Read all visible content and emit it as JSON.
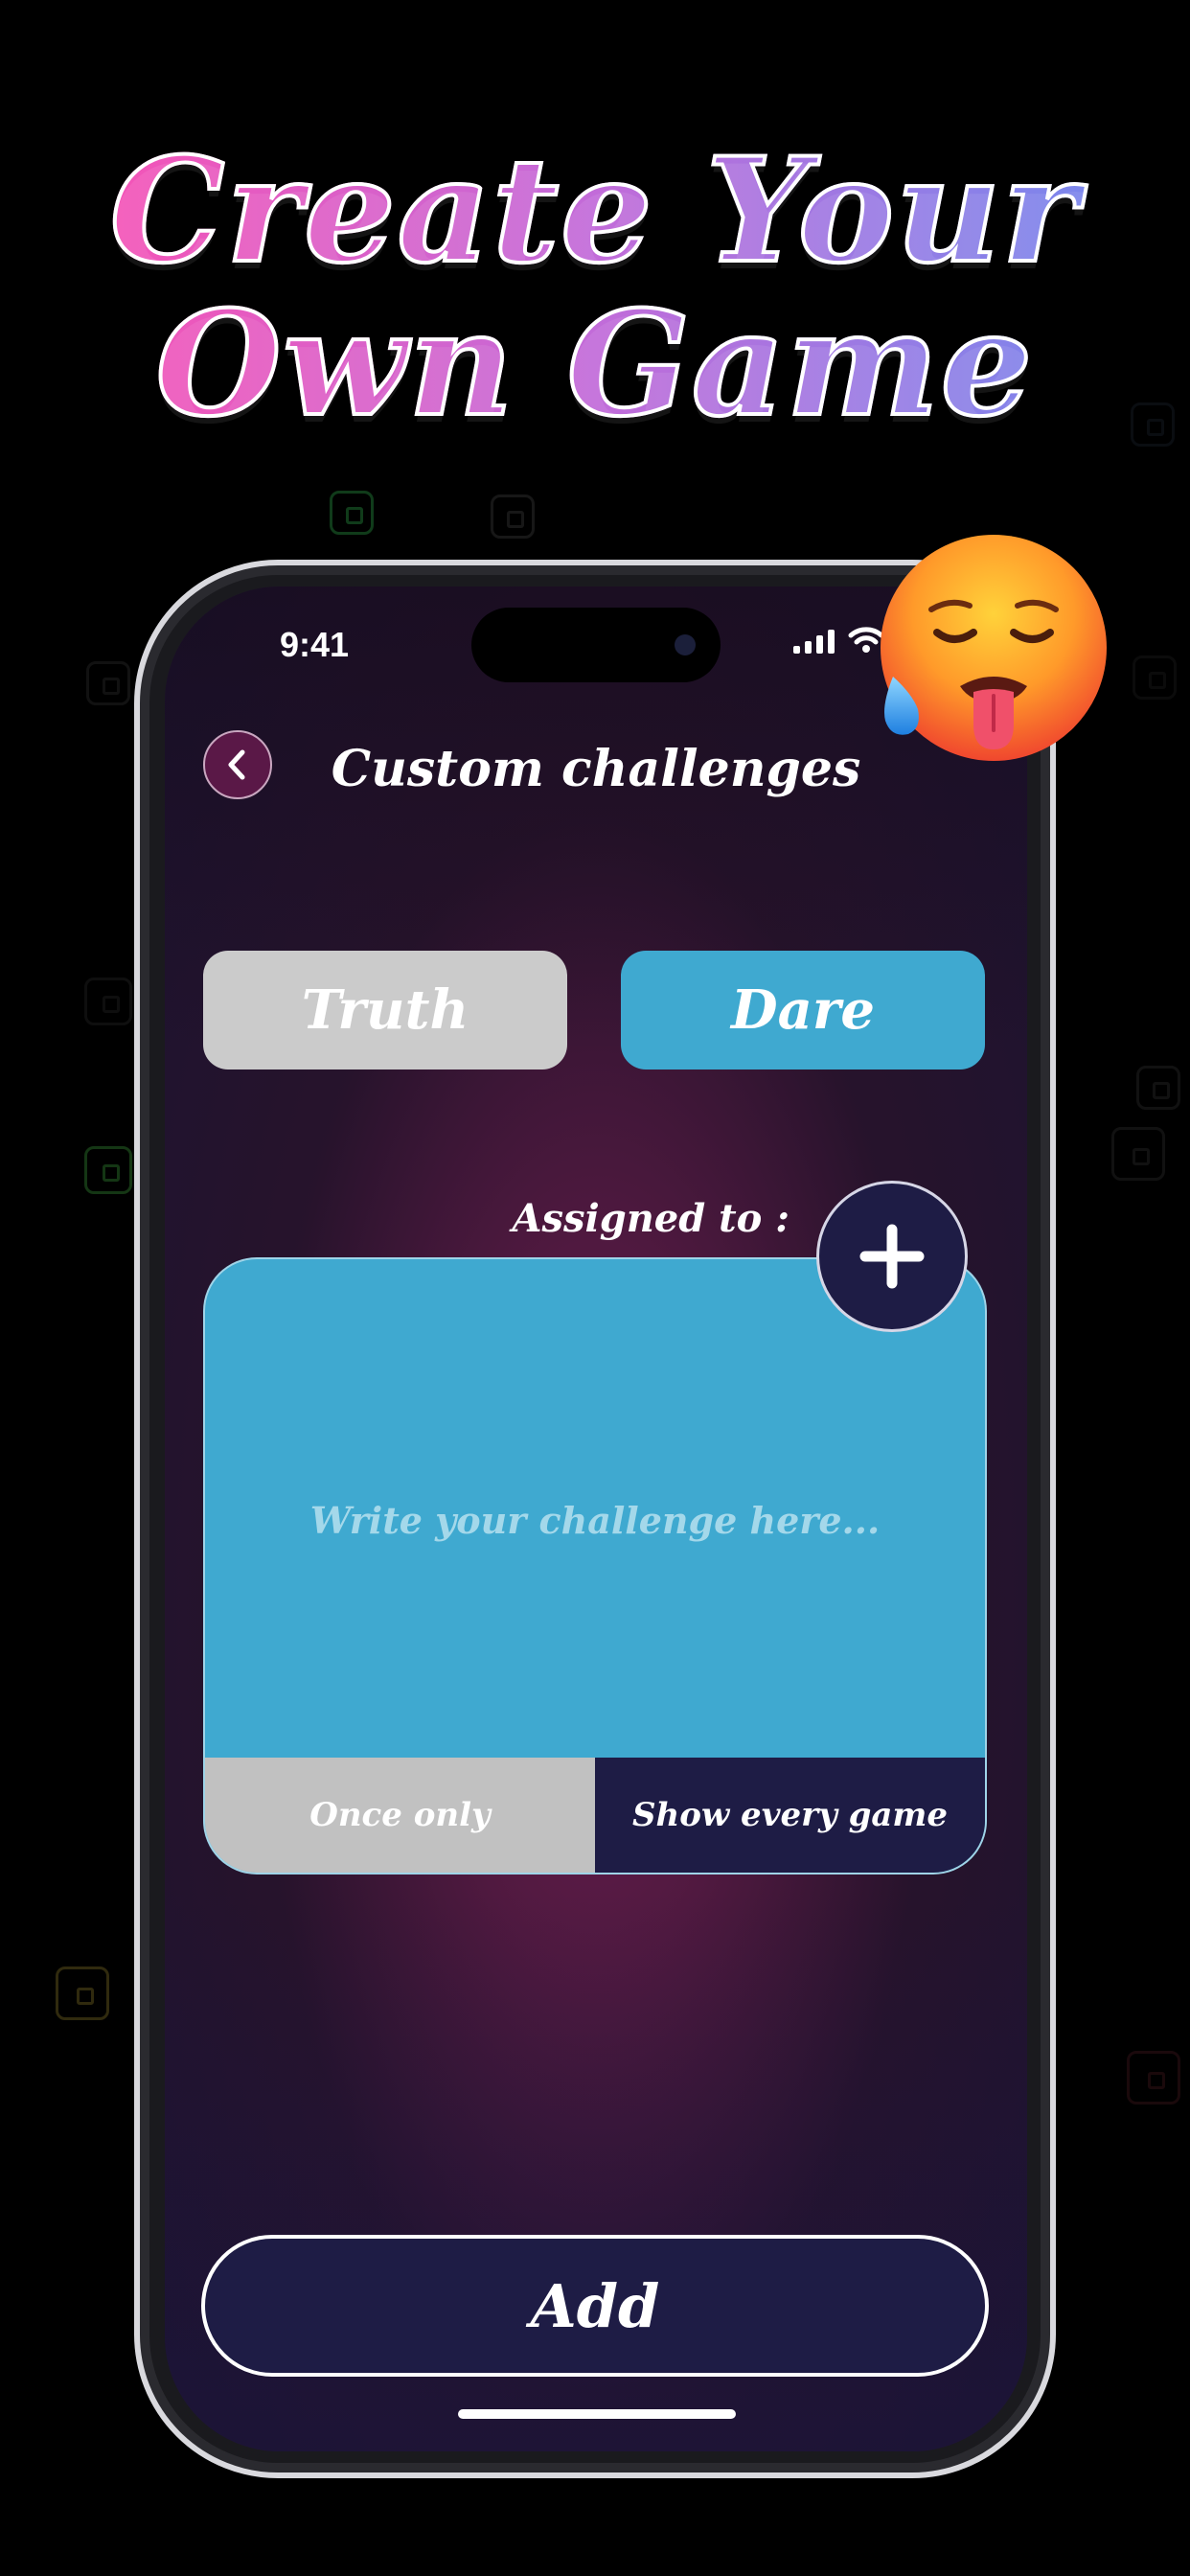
{
  "headline": {
    "line1": "Create Your",
    "line2": "Own Game"
  },
  "status_bar": {
    "time": "9:41"
  },
  "nav": {
    "title": "Custom challenges"
  },
  "segments": {
    "truth": "Truth",
    "dare": "Dare",
    "selected": "Dare"
  },
  "assigned": {
    "label": "Assigned to :"
  },
  "challenge": {
    "placeholder": "Write your challenge here...",
    "value": "",
    "options": {
      "once": "Once only",
      "every": "Show every game",
      "selected": "Show every game"
    }
  },
  "actions": {
    "add": "Add"
  },
  "colors": {
    "accent": "#3fa9d0",
    "navy": "#1e1c45",
    "grey": "#c1c1c1"
  },
  "icons": [
    "back-chevron-icon",
    "plus-icon",
    "signal-icon",
    "wifi-icon",
    "hot-face-emoji-icon"
  ]
}
